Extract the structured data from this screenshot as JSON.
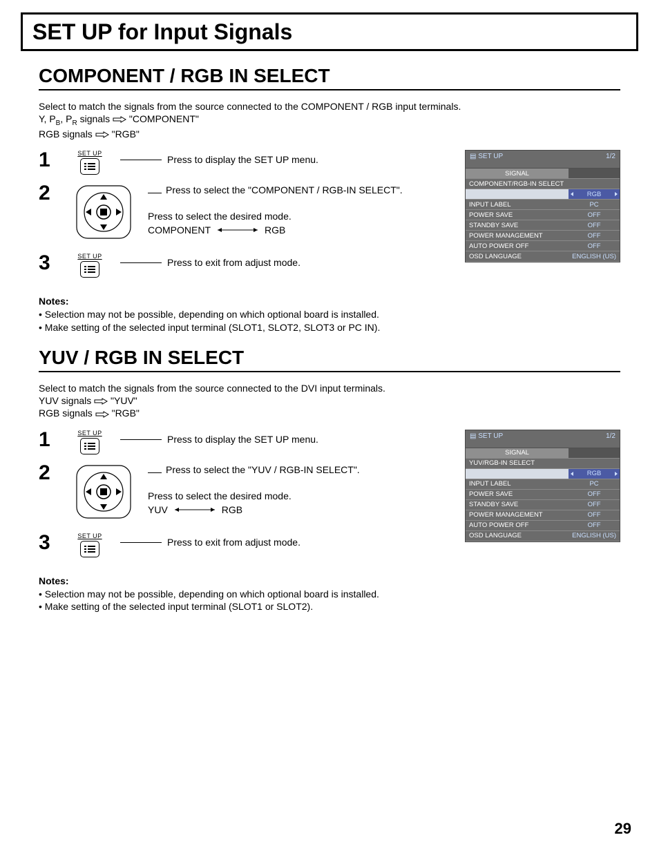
{
  "page_title": "SET UP for Input Signals",
  "page_number": "29",
  "sections": [
    {
      "title": "COMPONENT / RGB IN SELECT",
      "intro_lines": [
        "Select to match the signals from the source connected to the COMPONENT / RGB input terminals.",
        "Y, P_B, P_R signals ⇨ \"COMPONENT\"",
        "RGB signals ⇨ \"RGB\""
      ],
      "steps": [
        {
          "num": "1",
          "btn": "SET UP",
          "lines": [
            "Press to display the SET UP menu."
          ]
        },
        {
          "num": "2",
          "btn": "",
          "lines": [
            "Press to select the \"COMPONENT / RGB-IN SELECT\".",
            "Press to select the desired mode."
          ],
          "mode_left": "COMPONENT",
          "mode_right": "RGB"
        },
        {
          "num": "3",
          "btn": "SET UP",
          "lines": [
            "Press to exit from adjust mode."
          ]
        }
      ],
      "osd": {
        "title": "SET UP",
        "page": "1/2",
        "row1": "COMPONENT/RGB-IN SELECT",
        "rows": [
          {
            "l": "SIGNAL",
            "v": "",
            "sig": true
          },
          {
            "l": "COMPONENT/RGB-IN SELECT",
            "v": "",
            "span": true
          },
          {
            "l": "",
            "v": "RGB",
            "hl": true
          },
          {
            "l": "INPUT LABEL",
            "v": "PC"
          },
          {
            "l": "POWER SAVE",
            "v": "OFF"
          },
          {
            "l": "STANDBY SAVE",
            "v": "OFF"
          },
          {
            "l": "POWER MANAGEMENT",
            "v": "OFF"
          },
          {
            "l": "AUTO POWER OFF",
            "v": "OFF"
          },
          {
            "l": "OSD LANGUAGE",
            "v": "ENGLISH (US)"
          }
        ]
      },
      "notes_title": "Notes:",
      "notes": [
        "Selection may not be possible, depending on which optional board is installed.",
        "Make setting of the selected input terminal (SLOT1, SLOT2, SLOT3 or PC IN)."
      ]
    },
    {
      "title": "YUV / RGB IN SELECT",
      "intro_lines": [
        "Select to match the signals from the source connected to the DVI input terminals.",
        "YUV signals ⇨ \"YUV\"",
        "RGB signals ⇨ \"RGB\""
      ],
      "steps": [
        {
          "num": "1",
          "btn": "SET UP",
          "lines": [
            "Press to display the SET UP menu."
          ]
        },
        {
          "num": "2",
          "btn": "",
          "lines": [
            "Press to select the \"YUV / RGB-IN SELECT\".",
            "Press to select the desired mode."
          ],
          "mode_left": "YUV",
          "mode_right": "RGB"
        },
        {
          "num": "3",
          "btn": "SET UP",
          "lines": [
            "Press to exit from adjust mode."
          ]
        }
      ],
      "osd": {
        "title": "SET UP",
        "page": "1/2",
        "rows": [
          {
            "l": "SIGNAL",
            "v": "",
            "sig": true
          },
          {
            "l": "YUV/RGB-IN SELECT",
            "v": "",
            "span": true
          },
          {
            "l": "",
            "v": "RGB",
            "hl": true
          },
          {
            "l": "INPUT LABEL",
            "v": "PC"
          },
          {
            "l": "POWER SAVE",
            "v": "OFF"
          },
          {
            "l": "STANDBY SAVE",
            "v": "OFF"
          },
          {
            "l": "POWER MANAGEMENT",
            "v": "OFF"
          },
          {
            "l": "AUTO POWER OFF",
            "v": "OFF"
          },
          {
            "l": "OSD LANGUAGE",
            "v": "ENGLISH (US)"
          }
        ]
      },
      "notes_title": "Notes:",
      "notes": [
        "Selection may not be possible, depending on which optional board is installed.",
        "Make setting of the selected input terminal (SLOT1 or SLOT2)."
      ]
    }
  ]
}
